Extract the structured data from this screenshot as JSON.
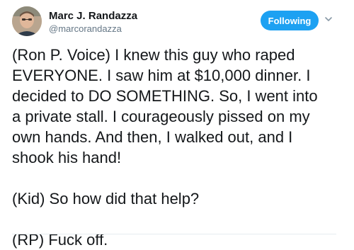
{
  "author": {
    "name": "Marc J. Randazza",
    "handle": "@marcorandazza"
  },
  "follow_button": {
    "label": "Following"
  },
  "icons": {
    "avatar": "profile-photo",
    "menu": "chevron-down-icon"
  },
  "tweet": {
    "paragraph_1_lines": [
      "(Ron P. Voice) I knew this guy who raped",
      "EVERYONE. I saw him at $10,000 dinner. I",
      "decided to DO SOMETHING. So, I went into",
      "a private stall. I courageously pissed on my",
      "own hands. And then, I walked out, and I",
      "shook his hand!"
    ],
    "paragraph_2": "(Kid) So how did that help?",
    "paragraph_3": "(RP) Fuck off."
  },
  "colors": {
    "accent": "#1da1f2",
    "text": "#14171a",
    "secondary_text": "#657786"
  }
}
